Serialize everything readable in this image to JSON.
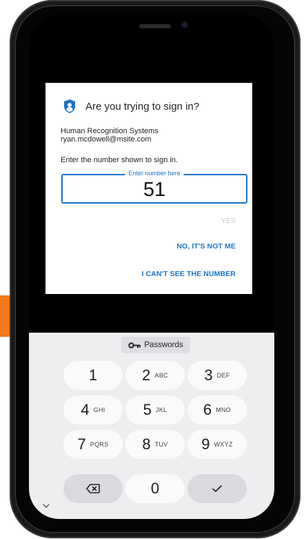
{
  "dialog": {
    "title": "Are you trying to sign in?",
    "org_name": "Human Recognition Systems",
    "account": "ryan.mcdowell@msite.com",
    "prompt": "Enter the number shown to sign in.",
    "number_field": {
      "label": "Enter number here",
      "value": "51"
    },
    "actions": {
      "yes": "YES",
      "not_me": "NO, IT'S NOT ME",
      "cant_see": "I CAN'T SEE THE NUMBER"
    },
    "icon": "shield-icon"
  },
  "keyboard": {
    "suggestion": "Passwords",
    "keys": [
      {
        "digit": "1",
        "letters": ""
      },
      {
        "digit": "2",
        "letters": "ABC"
      },
      {
        "digit": "3",
        "letters": "DEF"
      },
      {
        "digit": "4",
        "letters": "GHI"
      },
      {
        "digit": "5",
        "letters": "JKL"
      },
      {
        "digit": "6",
        "letters": "MNO"
      },
      {
        "digit": "7",
        "letters": "PQRS"
      },
      {
        "digit": "8",
        "letters": "TUV"
      },
      {
        "digit": "9",
        "letters": "WXYZ"
      },
      {
        "digit": "0",
        "letters": ""
      }
    ]
  },
  "colors": {
    "accent": "#1a73c8",
    "arrow": "#f47a1f",
    "keyboard_bg": "#eceef0"
  }
}
